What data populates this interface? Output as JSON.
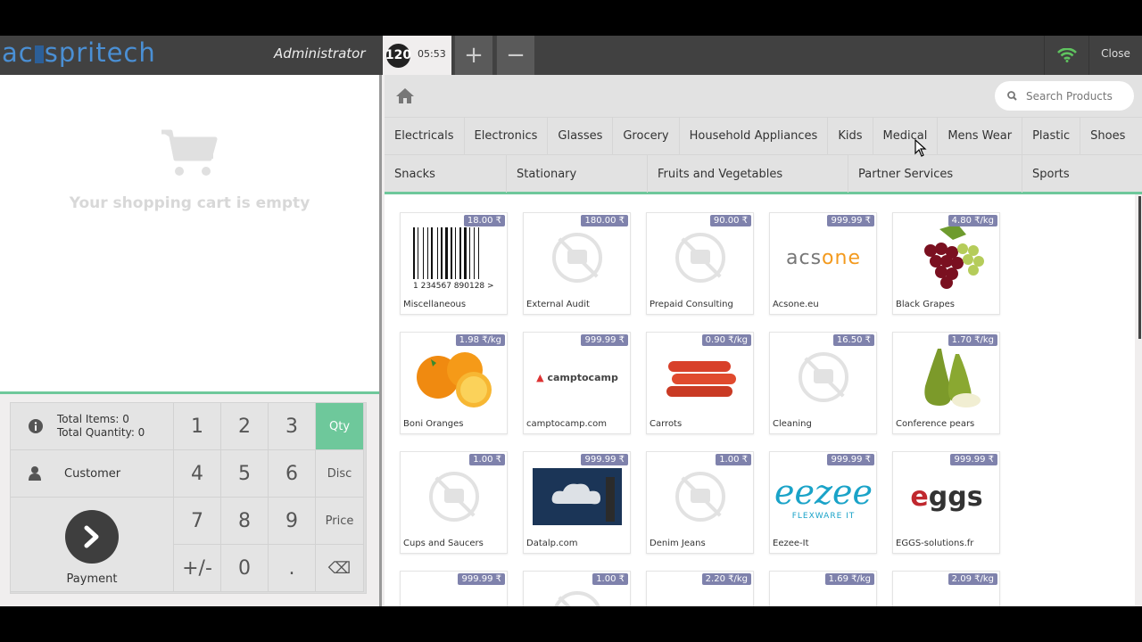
{
  "header": {
    "logo_text": "acsspritech",
    "user": "Administrator",
    "order_number": "120",
    "order_time": "05:53",
    "add_label": "+",
    "remove_label": "−",
    "close_label": "Close",
    "wifi_color": "#5fc35f"
  },
  "cart": {
    "empty_text": "Your shopping cart is empty"
  },
  "numpad": {
    "total_items": "Total Items: 0",
    "total_quantity": "Total Quantity: 0",
    "customer": "Customer",
    "payment": "Payment",
    "keys": [
      "1",
      "2",
      "3",
      "Qty",
      "4",
      "5",
      "6",
      "Disc",
      "7",
      "8",
      "9",
      "Price",
      "+/-",
      "0",
      ".",
      "⌫"
    ]
  },
  "search": {
    "placeholder": "Search Products"
  },
  "categories": {
    "row1": [
      "Electricals",
      "Electronics",
      "Glasses",
      "Grocery",
      "Household Appliances",
      "Kids",
      "Medical",
      "Mens Wear",
      "Plastic",
      "Shoes"
    ],
    "row2": [
      "Snacks",
      "Stationary",
      "Fruits and Vegetables",
      "Partner Services",
      "Sports"
    ]
  },
  "products": [
    {
      "name": "Miscellaneous",
      "price": "18.00 ₹",
      "img": "barcode"
    },
    {
      "name": "External Audit",
      "price": "180.00 ₹",
      "img": "none"
    },
    {
      "name": "Prepaid Consulting",
      "price": "90.00 ₹",
      "img": "none"
    },
    {
      "name": "Acsone.eu",
      "price": "999.99 ₹",
      "img": "acsone"
    },
    {
      "name": "Black Grapes",
      "price": "4.80 ₹/kg",
      "img": "grapes"
    },
    {
      "name": "Boni Oranges",
      "price": "1.98 ₹/kg",
      "img": "oranges"
    },
    {
      "name": "camptocamp.com",
      "price": "999.99 ₹",
      "img": "camptocamp"
    },
    {
      "name": "Carrots",
      "price": "0.90 ₹/kg",
      "img": "carrots"
    },
    {
      "name": "Cleaning",
      "price": "16.50 ₹",
      "img": "none"
    },
    {
      "name": "Conference pears",
      "price": "1.70 ₹/kg",
      "img": "pears"
    },
    {
      "name": "Cups and Saucers",
      "price": "1.00 ₹",
      "img": "none"
    },
    {
      "name": "Datalp.com",
      "price": "999.99 ₹",
      "img": "datalp"
    },
    {
      "name": "Denim Jeans",
      "price": "1.00 ₹",
      "img": "none"
    },
    {
      "name": "Eezee-It",
      "price": "999.99 ₹",
      "img": "eezee"
    },
    {
      "name": "EGGS-solutions.fr",
      "price": "999.99 ₹",
      "img": "eggs"
    },
    {
      "name": "",
      "price": "999.99 ₹",
      "img": "blank"
    },
    {
      "name": "",
      "price": "1.00 ₹",
      "img": "none"
    },
    {
      "name": "",
      "price": "2.20 ₹/kg",
      "img": "blank"
    },
    {
      "name": "",
      "price": "1.69 ₹/kg",
      "img": "apple"
    },
    {
      "name": "",
      "price": "2.09 ₹/kg",
      "img": "apple"
    }
  ],
  "colors": {
    "accent": "#6ec89b",
    "price_badge": "#7f82ac",
    "topbar": "#414141"
  }
}
